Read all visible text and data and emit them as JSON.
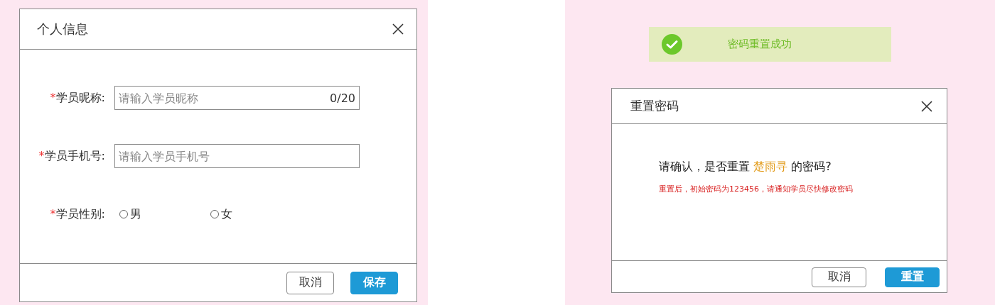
{
  "profile_dialog": {
    "title": "个人信息",
    "fields": [
      {
        "kind": "text",
        "label": "学员昵称:",
        "required_mark": "*",
        "placeholder": "请输入学员昵称",
        "counter": "0/20"
      },
      {
        "kind": "text",
        "label": "学员手机号:",
        "required_mark": "*",
        "placeholder": "请输入学员手机号"
      },
      {
        "kind": "radio",
        "label": "学员性别:",
        "required_mark": "*",
        "options": [
          {
            "label": "男",
            "selected": false
          },
          {
            "label": "女",
            "selected": false
          }
        ]
      }
    ],
    "buttons": [
      {
        "label": "取消",
        "kind": "secondary"
      },
      {
        "label": "保存",
        "kind": "primary"
      }
    ]
  },
  "toast": {
    "kind": "success",
    "message": "密码重置成功"
  },
  "reset_dialog": {
    "title": "重置密码",
    "message": {
      "before": "请确认，是否重置 ",
      "name": "楚雨寻",
      "after": " 的密码?"
    },
    "note": "重置后，初始密码为123456，请通知学员尽快修改密码",
    "buttons": [
      {
        "label": "取消",
        "kind": "secondary"
      },
      {
        "label": "重置",
        "kind": "primary"
      }
    ]
  }
}
